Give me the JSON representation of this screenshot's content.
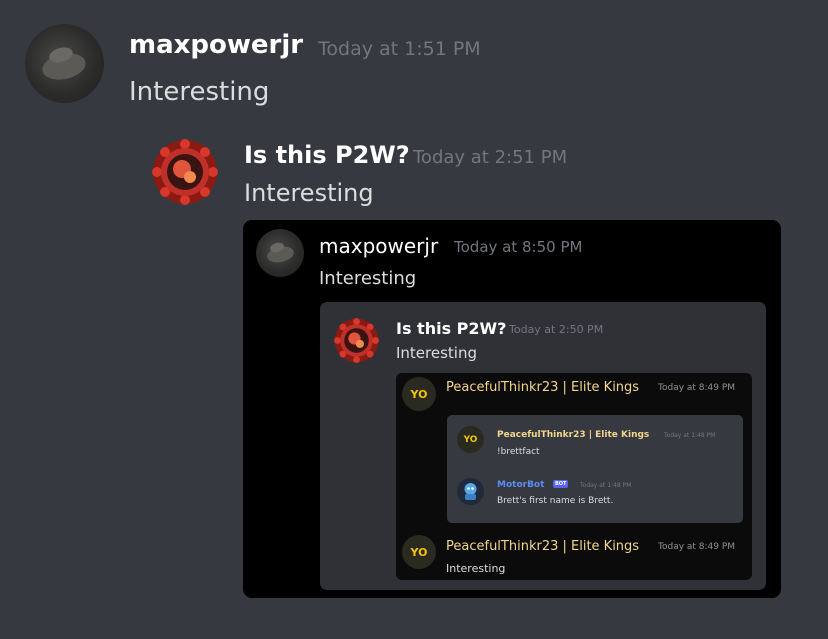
{
  "messages": [
    {
      "author": "maxpowerjr",
      "timestamp": "Today at 1:51 PM",
      "content": "Interesting"
    },
    {
      "author": "Is this P2W?",
      "timestamp": "Today at 2:51 PM",
      "content": "Interesting"
    }
  ],
  "quote1": {
    "author": "maxpowerjr",
    "timestamp": "Today at 8:50 PM",
    "content": "Interesting"
  },
  "quote2": {
    "author": "Is this P2W?",
    "timestamp": "Today at 2:50 PM",
    "content": "Interesting"
  },
  "quote3": {
    "author": "PeacefulThinkr23 | Elite Kings",
    "timestamp": "Today at 8:49 PM",
    "avatar_text": "YO"
  },
  "quote4": {
    "msg1": {
      "author": "PeacefulThinkr23 | Elite Kings",
      "timestamp": "Today at 1:48 PM",
      "content": "!brettfact",
      "avatar_text": "YO"
    },
    "msg2": {
      "author": "MotorBot",
      "badge": "BOT",
      "timestamp": "Today at 1:48 PM",
      "content": "Brett's first name is Brett."
    }
  },
  "quote3_footer": {
    "author": "PeacefulThinkr23 | Elite Kings",
    "timestamp": "Today at 8:49 PM",
    "content": "Interesting",
    "avatar_text": "YO"
  },
  "colors": {
    "background": "#36393f",
    "username_gold": "#f4d58d",
    "bot_blue": "#5c8cf2",
    "timestamp": "#72767d"
  }
}
